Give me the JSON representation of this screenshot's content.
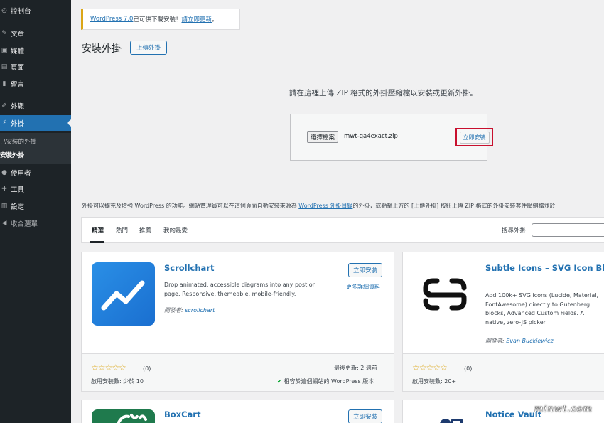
{
  "sidebar": {
    "items": [
      {
        "label": "控制台",
        "icon": "dashboard-icon",
        "glyph": "◴"
      },
      {
        "label": "文章",
        "icon": "pin-icon",
        "glyph": "✎"
      },
      {
        "label": "媒體",
        "icon": "media-icon",
        "glyph": "▣"
      },
      {
        "label": "頁面",
        "icon": "page-icon",
        "glyph": "▤"
      },
      {
        "label": "留言",
        "icon": "comment-icon",
        "glyph": "▮"
      },
      {
        "label": "外觀",
        "icon": "brush-icon",
        "glyph": "✐"
      },
      {
        "label": "外掛",
        "icon": "plugin-icon",
        "glyph": "⚡"
      },
      {
        "label": "使用者",
        "icon": "user-icon",
        "glyph": "●"
      },
      {
        "label": "工具",
        "icon": "wrench-icon",
        "glyph": "✚"
      },
      {
        "label": "設定",
        "icon": "settings-icon",
        "glyph": "▥"
      },
      {
        "label": "收合選單",
        "icon": "collapse-icon",
        "glyph": "◀"
      }
    ],
    "submenu": [
      "已安裝的外掛",
      "安裝外掛"
    ]
  },
  "notice": {
    "link": "WordPress 7.0",
    "text": " 已可供下載安裝！",
    "update_link": "請立即更新",
    "end": "。"
  },
  "page": {
    "title": "安裝外掛",
    "upload_button": "上傳外掛"
  },
  "upload": {
    "help": "請在這裡上傳 ZIP 格式的外掛壓縮檔以安裝或更新外掛。",
    "choose_file": "選擇檔案",
    "file_name": "mwt-ga4exact.zip",
    "install_now": "立即安裝"
  },
  "description": {
    "text1": "外掛可以擴充及增強 WordPress 的功能。網站管理員可以在這個頁面自動安裝來源為 ",
    "link": "WordPress 外掛目錄",
    "text2": "的外掛，或點擊上方的 [上傳外掛] 按鈕上傳 ZIP 格式的外掛安裝套件壓縮檔並於"
  },
  "filter": {
    "tabs": [
      "精選",
      "熱門",
      "推薦",
      "我的最愛"
    ],
    "search_label": "搜尋外掛"
  },
  "plugins": [
    {
      "title": "Scrollchart",
      "description": "Drop animated, accessible diagrams into any post or page. Responsive, themeable, mobile-friendly.",
      "author_prefix": "開發者: ",
      "author": "scrollchart",
      "install": "立即安裝",
      "more": "更多詳細資料",
      "rating": "☆☆☆☆☆",
      "rating_count": "(0)",
      "installs": "啟用安裝數: 少於 10",
      "updated": "最後更新: 2 週前",
      "compat": "相容於這個網站的 WordPress 版本"
    },
    {
      "title": "Subtle Icons – SVG Icon Block, Icon Picker & ACF Field",
      "description": "Add 100k+ SVG icons (Lucide, Material, FontAwesome) directly to Gutenberg blocks, Advanced Custom Fields. A native, zero-JS picker.",
      "author_prefix": "開發者: ",
      "author": "Evan Buckiewicz",
      "rating": "☆☆☆☆☆",
      "rating_count": "(0)",
      "installs": "啟用安裝數: 20+"
    },
    {
      "title": "BoxCart",
      "install": "立即安裝"
    },
    {
      "title": "Notice Vault"
    }
  ],
  "watermark": "minwt.com",
  "colors": {
    "sidebar_bg": "#1d2327",
    "accent": "#2271b1",
    "highlight_box": "#c8102e",
    "notice_border": "#dba617"
  }
}
